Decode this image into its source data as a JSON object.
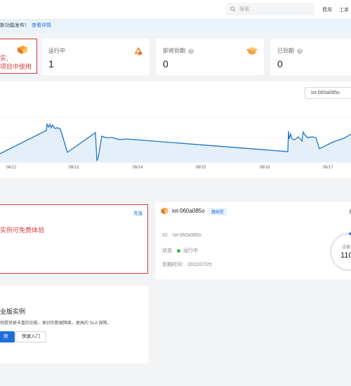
{
  "topbar": {
    "search_placeholder": "搜索...",
    "link1": "费用",
    "link2": "工单"
  },
  "notice": {
    "text": "新功能发布！",
    "link": "查看详情"
  },
  "stats": {
    "promo_line1": "实,",
    "promo_line2": "项目中使用",
    "running": {
      "label": "运行中",
      "value": "1"
    },
    "expiring": {
      "label": "即将到期",
      "value": "0"
    },
    "expired": {
      "label": "已到期",
      "value": "0"
    }
  },
  "chart": {
    "device": "iot-060a085o",
    "x_ticks": [
      "08/12",
      "08/13",
      "08/14",
      "08/15",
      "08/16",
      "08/17"
    ]
  },
  "chart_data": {
    "type": "line",
    "x": [
      "08/12",
      "08/13",
      "08/14",
      "08/15",
      "08/16",
      "08/17"
    ],
    "series": [
      {
        "values": [
          0.62,
          0.95,
          0.6,
          0.45,
          0.35,
          0.66
        ]
      }
    ],
    "grid": true
  },
  "promo": {
    "action": "充值",
    "text": "实例可免费体验"
  },
  "pro": {
    "title": "业版实例",
    "desc": "例提供更丰富的功能、更好的数据隔离，更高的 SLA 保障。",
    "btn_primary": "例",
    "btn_secondary": "快速入门"
  },
  "instance": {
    "name": "iot-060a085o",
    "badge": "基础型",
    "more": "升",
    "id_label": "ID:",
    "id_value": "iot-060a085o",
    "status_label": "状态:",
    "status_value": "运行中",
    "expire_label": "到期时间:",
    "expire_value": "2022/07/25",
    "gauge_label": "设备数",
    "gauge_value": "110"
  }
}
